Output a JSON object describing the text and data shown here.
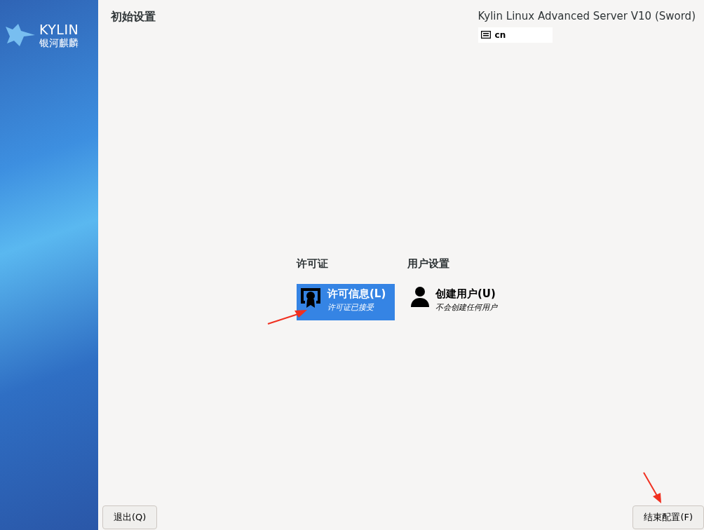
{
  "sidebar": {
    "logo_text": "KYLIN",
    "logo_subtitle": "银河麒麟"
  },
  "header": {
    "title": "初始设置",
    "product": "Kylin Linux Advanced Server V10 (Sword)",
    "keyboard_layout": "cn"
  },
  "categories": [
    {
      "title": "许可证",
      "items": [
        {
          "kind": "license",
          "label": "许可信息(L)",
          "status": "许可证已接受",
          "selected": true
        }
      ]
    },
    {
      "title": "用户设置",
      "items": [
        {
          "kind": "user",
          "label": "创建用户(U)",
          "status": "不会创建任何用户",
          "selected": false
        }
      ]
    }
  ],
  "buttons": {
    "quit": "退出(Q)",
    "finish": "结束配置(F)"
  }
}
